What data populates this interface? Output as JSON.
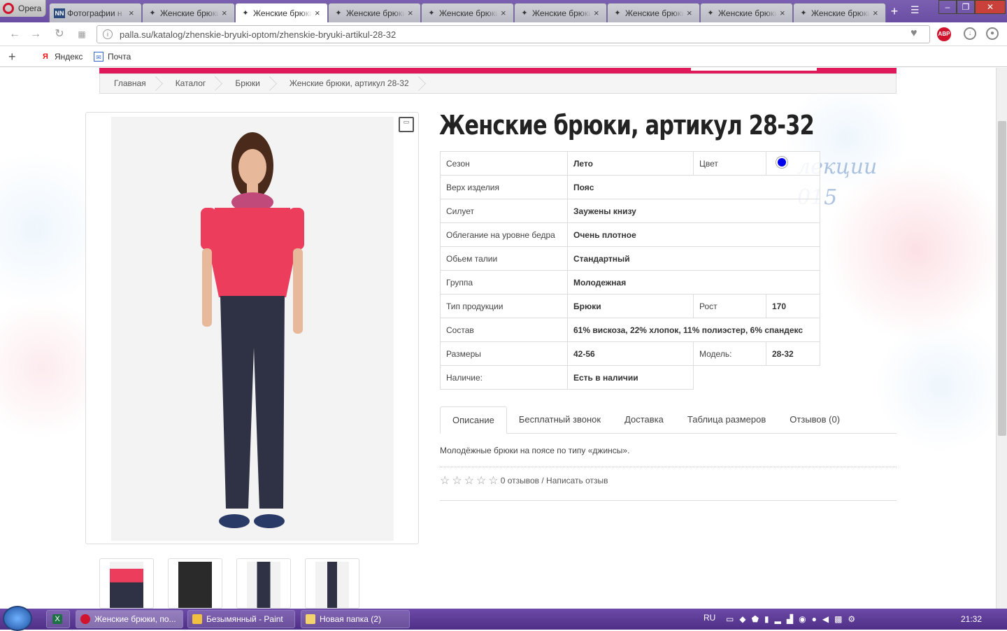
{
  "browser": {
    "app_label": "Opera",
    "tabs": [
      {
        "label": "Фотографии н",
        "favicon": "NN"
      },
      {
        "label": "Женские брюки",
        "favicon": "palla"
      },
      {
        "label": "Женские брюки",
        "favicon": "palla",
        "active": true
      },
      {
        "label": "Женские брюки",
        "favicon": "palla"
      },
      {
        "label": "Женские брюки",
        "favicon": "palla"
      },
      {
        "label": "Женские брюки",
        "favicon": "palla"
      },
      {
        "label": "Женские брюки",
        "favicon": "palla"
      },
      {
        "label": "Женские брюки",
        "favicon": "palla"
      },
      {
        "label": "Женские брюки",
        "favicon": "palla"
      }
    ],
    "url": "palla.su/katalog/zhenskie-bryuki-optom/zhenskie-bryuki-artikul-28-32",
    "abp_label": "ABP",
    "bookmarks": [
      {
        "label": "Яндекс"
      },
      {
        "label": "Почта"
      }
    ]
  },
  "page": {
    "breadcrumb": [
      "Главная",
      "Каталог",
      "Брюки",
      "Женские брюки, артикул 28-32"
    ],
    "product_title": "Женские брюки, артикул 28-32",
    "watermark_text": "лекции\n015",
    "attributes": [
      {
        "label": "Сезон",
        "value": "Лето",
        "label2": "Цвет",
        "color": "#0000ee"
      },
      {
        "label": "Верх изделия",
        "value": "Пояс"
      },
      {
        "label": "Силует",
        "value": "Заужены книзу"
      },
      {
        "label": "Облегание на уровне бедра",
        "value": "Очень плотное"
      },
      {
        "label": "Обьем талии",
        "value": "Стандартный"
      },
      {
        "label": "Группа",
        "value": "Молодежная"
      },
      {
        "label": "Тип продукции",
        "value": "Брюки",
        "label2": "Рост",
        "value2": "170"
      },
      {
        "label": "Состав",
        "value": "61% вискоза, 22% хлопок, 11% полиэстер, 6% спандекс"
      },
      {
        "label": "Размеры",
        "value": "42-56",
        "label2": "Модель:",
        "value2": "28-32"
      },
      {
        "label": "Наличие:",
        "value": "Есть в наличии"
      }
    ],
    "product_tabs": [
      "Описание",
      "Бесплатный звонок",
      "Доставка",
      "Таблица размеров",
      "Отзывов (0)"
    ],
    "description": "Молодёжные брюки на поясе по типу «джинсы».",
    "rating_text": "0 отзывов / Написать отзыв",
    "rating_stars": 0
  },
  "taskbar": {
    "items": [
      {
        "label": "Женские брюки, по...",
        "icon": "opera-icon"
      },
      {
        "label": "Безымянный - Paint",
        "icon": "paint-icon"
      },
      {
        "label": "Новая папка (2)",
        "icon": "folder-icon"
      }
    ],
    "lang": "RU",
    "clock": "21:32"
  },
  "colors": {
    "accent": "#e0195a",
    "titlebar": "#6a4ea3",
    "selected_color_swatch": "#0000ee"
  }
}
